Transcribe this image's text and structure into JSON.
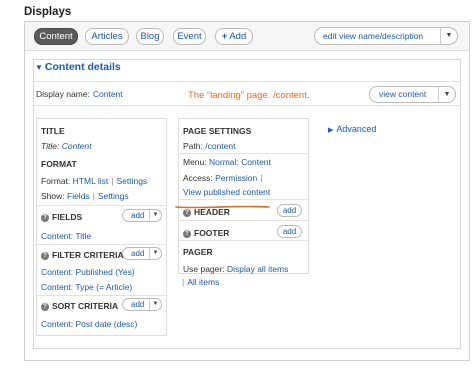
{
  "page": {
    "title": "Displays"
  },
  "tabs": [
    {
      "label": "Content",
      "active": true
    },
    {
      "label": "Articles"
    },
    {
      "label": "Blog"
    },
    {
      "label": "Event"
    },
    {
      "label": "Add",
      "icon": "plus-icon"
    }
  ],
  "edit_view": {
    "label": "edit view name/description"
  },
  "details": {
    "title": "Content details",
    "display_name_label": "Display name:",
    "display_name_value": "Content",
    "annotation": "The “landing” page.   /content.",
    "view_button": "view content"
  },
  "left": {
    "title_heading": "TITLE",
    "title_label": "Title:",
    "title_value": "Content",
    "format_heading": "FORMAT",
    "format_label": "Format:",
    "format_value": "HTML list",
    "format_settings": "Settings",
    "show_label": "Show:",
    "show_value": "Fields",
    "show_settings": "Settings",
    "fields_heading": "FIELDS",
    "fields_add": "add",
    "fields_item": "Content: Title",
    "filter_heading": "FILTER CRITERIA",
    "filter_add": "add",
    "filter_items": [
      "Content: Published (Yes)",
      "Content: Type (= Article)"
    ],
    "sort_heading": "SORT CRITERIA",
    "sort_add": "add",
    "sort_item": "Content: Post date (desc)"
  },
  "middle": {
    "page_settings_heading": "PAGE SETTINGS",
    "path_label": "Path:",
    "path_value": "/content",
    "menu_label": "Menu:",
    "menu_value": "Normal: Content",
    "access_label": "Access:",
    "access_value": "Permission",
    "view_published": "View published content",
    "header_heading": "HEADER",
    "header_add": "add",
    "footer_heading": "FOOTER",
    "footer_add": "add",
    "pager_heading": "PAGER",
    "pager_label": "Use pager:",
    "pager_value": "Display all items",
    "pager_all": "All items"
  },
  "right": {
    "advanced": "Advanced"
  },
  "colors": {
    "link": "#1e5aa8",
    "annotation": "#e86a1a",
    "active_tab": "#5b5b5b"
  }
}
